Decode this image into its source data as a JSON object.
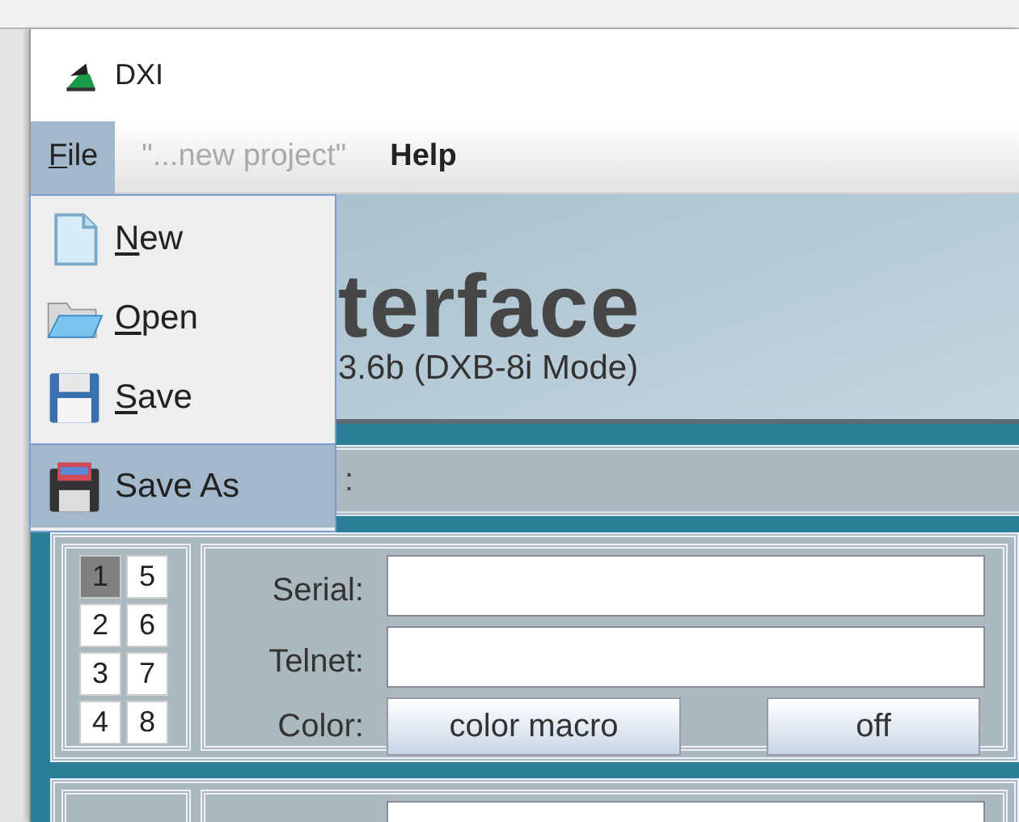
{
  "window": {
    "title": "DXI"
  },
  "menu_bar": [
    {
      "label": "File",
      "selected": true,
      "disabled": false,
      "bold": false,
      "underline_first": true
    },
    {
      "label": "\"...new project\"",
      "selected": false,
      "disabled": true,
      "bold": false,
      "underline_first": false
    },
    {
      "label": "Help",
      "selected": false,
      "disabled": false,
      "bold": true,
      "underline_first": false
    }
  ],
  "file_menu": [
    {
      "label": "New",
      "kind": "new",
      "selected": false,
      "underline_first": true
    },
    {
      "label": "Open",
      "kind": "open",
      "selected": false,
      "underline_first": true
    },
    {
      "label": "Save",
      "kind": "save",
      "selected": false,
      "underline_first": true
    },
    {
      "label": "Save As",
      "kind": "saveas",
      "selected": true,
      "underline_first": false
    }
  ],
  "header": {
    "title": "terface",
    "subtitle": "3.6b (DXB-8i Mode)"
  },
  "toolbar_row": {
    "label": ":"
  },
  "devices": [
    {
      "channels": [
        {
          "label": "1",
          "selected": true
        },
        {
          "label": "5",
          "selected": false
        },
        {
          "label": "2",
          "selected": false
        },
        {
          "label": "6",
          "selected": false
        },
        {
          "label": "3",
          "selected": false
        },
        {
          "label": "7",
          "selected": false
        },
        {
          "label": "4",
          "selected": false
        },
        {
          "label": "8",
          "selected": false
        }
      ],
      "fields": [
        {
          "label": "Serial:"
        },
        {
          "label": "Telnet:"
        }
      ],
      "color": {
        "label": "Color:",
        "buttons": [
          "color macro",
          "off"
        ]
      }
    }
  ]
}
